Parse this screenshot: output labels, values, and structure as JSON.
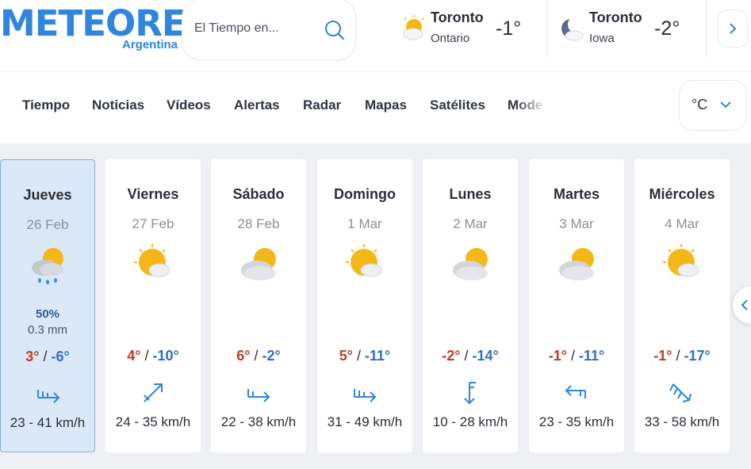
{
  "brand": {
    "name": "METEORED",
    "country": "Argentina",
    "color": "#2f86dd"
  },
  "search": {
    "placeholder": "El Tiempo en...",
    "icon": "search-icon"
  },
  "recent_cities": [
    {
      "name": "Toronto",
      "region": "Ontario",
      "temp": "-1°",
      "icon": "partly-cloudy-sun-icon"
    },
    {
      "name": "Toronto",
      "region": "Iowa",
      "temp": "-2°",
      "icon": "crescent-moon-icon"
    }
  ],
  "nav": {
    "items": [
      "Tiempo",
      "Noticias",
      "Vídeos",
      "Alertas",
      "Radar",
      "Mapas",
      "Satélites",
      "Mode"
    ],
    "unit": "°C"
  },
  "forecast": [
    {
      "day": "Jueves",
      "date": "26 Feb",
      "icon": "sun-cloud-rain-icon",
      "precip_pct": "50%",
      "precip_mm": "0.3 mm",
      "max": "3°",
      "min": "-6°",
      "wind_icon": "wind-arrow-east-icon",
      "wind": "23 - 41 km/h"
    },
    {
      "day": "Viernes",
      "date": "27 Feb",
      "icon": "sun-small-cloud-icon",
      "precip_pct": "",
      "precip_mm": "",
      "max": "4°",
      "min": "-10°",
      "wind_icon": "wind-arrow-northeast-icon",
      "wind": "24 - 35 km/h"
    },
    {
      "day": "Sábado",
      "date": "28 Feb",
      "icon": "cloud-sun-icon",
      "precip_pct": "",
      "precip_mm": "",
      "max": "6°",
      "min": "-2°",
      "wind_icon": "wind-arrow-east-icon",
      "wind": "22 - 38 km/h"
    },
    {
      "day": "Domingo",
      "date": "1 Mar",
      "icon": "sun-small-cloud-icon",
      "precip_pct": "",
      "precip_mm": "",
      "max": "5°",
      "min": "-11°",
      "wind_icon": "wind-arrow-east-icon",
      "wind": "31 - 49 km/h"
    },
    {
      "day": "Lunes",
      "date": "2 Mar",
      "icon": "cloud-sun-icon",
      "precip_pct": "",
      "precip_mm": "",
      "max": "-2°",
      "min": "-14°",
      "wind_icon": "wind-arrow-south-icon",
      "wind": "10 - 28 km/h"
    },
    {
      "day": "Martes",
      "date": "3 Mar",
      "icon": "cloud-sun-icon",
      "precip_pct": "",
      "precip_mm": "",
      "max": "-1°",
      "min": "-11°",
      "wind_icon": "wind-arrow-west-icon",
      "wind": "23 - 35 km/h"
    },
    {
      "day": "Miércoles",
      "date": "4 Mar",
      "icon": "sun-small-cloud-icon",
      "precip_pct": "",
      "precip_mm": "",
      "max": "-1°",
      "min": "-17°",
      "wind_icon": "wind-arrow-southeast-icon",
      "wind": "33 - 58 km/h"
    }
  ],
  "colors": {
    "max_temp": "#c0392b",
    "min_temp": "#2f6fc5",
    "selected_day_bg": "#dbe8f7",
    "page_bg": "#eef0f4"
  }
}
